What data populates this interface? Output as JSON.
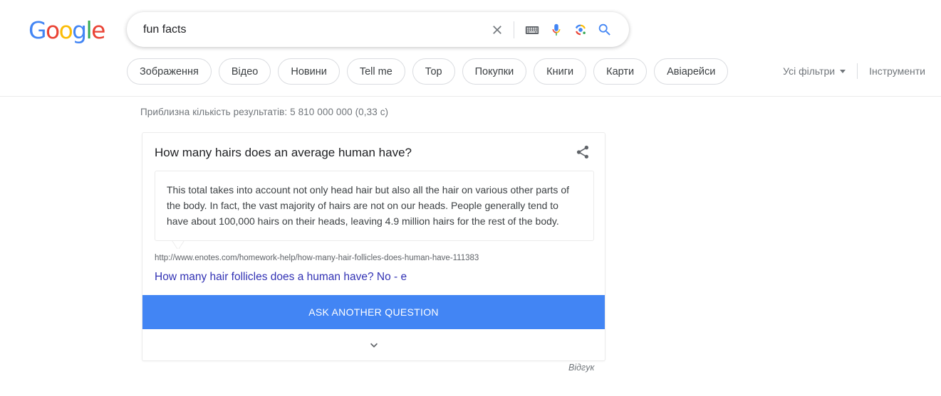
{
  "brand": {
    "logo_letters": [
      "G",
      "o",
      "o",
      "g",
      "l",
      "e"
    ],
    "colors": {
      "blue": "#4285F4",
      "red": "#EA4335",
      "yellow": "#FBBC05",
      "green": "#34A853",
      "link_purple": "#3232b4",
      "button_blue": "#4285F4"
    }
  },
  "search": {
    "query": "fun facts",
    "placeholder": "",
    "icons": {
      "clear": "close-icon",
      "keyboard": "keyboard-icon",
      "voice": "microphone-icon",
      "lens": "google-lens-icon",
      "submit": "search-icon"
    }
  },
  "filters": {
    "pills": [
      {
        "label": "Зображення"
      },
      {
        "label": "Відео"
      },
      {
        "label": "Новини"
      },
      {
        "label": "Tell me"
      },
      {
        "label": "Тор"
      },
      {
        "label": "Покупки"
      },
      {
        "label": "Книги"
      },
      {
        "label": "Карти"
      },
      {
        "label": "Авіарейси"
      }
    ],
    "all_filters_label": "Усі фільтри",
    "tools_label": "Інструменти"
  },
  "results": {
    "stats": "Приблизна кількість результатів: 5 810 000 000 (0,33 с)"
  },
  "answer_card": {
    "title": "How many hairs does an average human have?",
    "share_icon": "share-icon",
    "snippet": "This total takes into account not only head hair but also all the hair on various other parts of the body. In fact, the vast majority of hairs are not on our heads. People generally tend to have about 100,000 hairs on their heads, leaving 4.9 million hairs for the rest of the body.",
    "source_url": "http://www.enotes.com/homework-help/how-many-hair-follicles-does-human-have-111383",
    "source_title": "How many hair follicles does a human have? No - e",
    "ask_button_label": "ASK ANOTHER QUESTION",
    "expand_icon": "chevron-down-icon"
  },
  "footer": {
    "feedback_label": "Відгук"
  }
}
